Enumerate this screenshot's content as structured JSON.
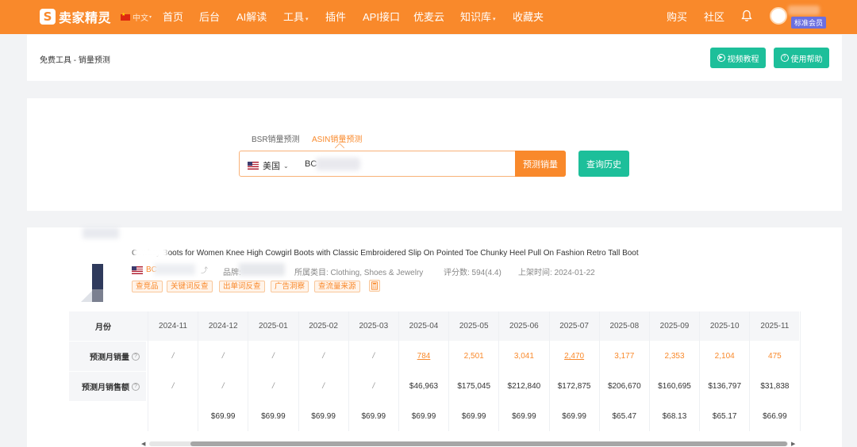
{
  "nav": {
    "logo_text": "卖家精灵",
    "lang": "中文",
    "items": [
      "首页",
      "后台",
      "AI解读",
      "工具",
      "插件",
      "API接口",
      "优麦云",
      "知识库",
      "收藏夹"
    ],
    "right_items": [
      "购买",
      "社区"
    ],
    "member_badge": "标准会员"
  },
  "breadcrumb": "免费工具 - 销量预测",
  "header_buttons": {
    "video": "视频教程",
    "help": "使用帮助"
  },
  "search": {
    "tabs": [
      "BSR销量预测",
      "ASIN销量预测"
    ],
    "active_tab": 1,
    "country": "美国",
    "asin_value": "BC",
    "predict_button": "预测销量",
    "history_button": "查询历史"
  },
  "product": {
    "title": "Cowboy Boots for Women Knee High Cowgirl Boots with Classic Embroidered Slip On Pointed Toe Chunky Heel Pull On Fashion Retro Tall Boot",
    "asin": "BC",
    "brand_label": "品牌:",
    "category": "所属类目: Clothing, Shoes & Jewelry",
    "rating": "评分数: 594(4.4)",
    "launch": "上架时间: 2024-01-22",
    "tags": [
      "查竞品",
      "关键词反查",
      "出单词反查",
      "广告洞察",
      "查流量来源"
    ]
  },
  "table": {
    "month_label": "月份",
    "volume_label": "预测月销量",
    "sales_label": "预测月销售额",
    "months": [
      "2024-11",
      "2024-12",
      "2025-01",
      "2025-02",
      "2025-03",
      "2025-04",
      "2025-05",
      "2025-06",
      "2025-07",
      "2025-08",
      "2025-09",
      "2025-10",
      "2025-11"
    ],
    "volumes": [
      "/",
      "/",
      "/",
      "/",
      "/",
      "784",
      "2,501",
      "3,041",
      "2,470",
      "3,177",
      "2,353",
      "2,104",
      "475"
    ],
    "sales": [
      "/",
      "/",
      "/",
      "/",
      "/",
      "$46,963",
      "$175,045",
      "$212,840",
      "$172,875",
      "$206,670",
      "$160,695",
      "$136,797",
      "$31,838"
    ],
    "prices": [
      "",
      "$69.99",
      "$69.99",
      "$69.99",
      "$69.99",
      "$69.99",
      "$69.99",
      "$69.99",
      "$69.99",
      "$65.47",
      "$68.13",
      "$65.17",
      "$66.99"
    ]
  },
  "colors": {
    "brand_orange": "#f9892b",
    "accent_green": "#1dbf9a",
    "badge_purple": "#6b6fe0"
  }
}
